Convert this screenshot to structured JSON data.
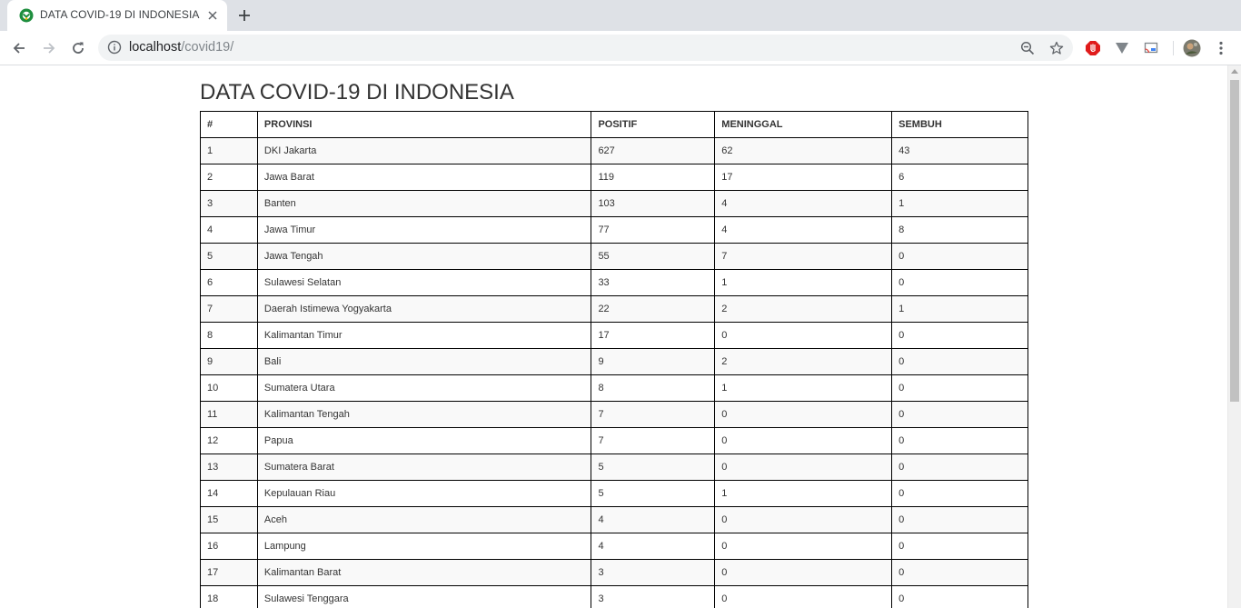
{
  "browser": {
    "tab_title": "DATA COVID-19 DI INDONESIA",
    "url_host": "localhost",
    "url_path": "/covid19/"
  },
  "page": {
    "title": "DATA COVID-19 DI INDONESIA",
    "table": {
      "headers": [
        "#",
        "PROVINSI",
        "POSITIF",
        "MENINGGAL",
        "SEMBUH"
      ],
      "rows": [
        [
          "1",
          "DKI Jakarta",
          "627",
          "62",
          "43"
        ],
        [
          "2",
          "Jawa Barat",
          "119",
          "17",
          "6"
        ],
        [
          "3",
          "Banten",
          "103",
          "4",
          "1"
        ],
        [
          "4",
          "Jawa Timur",
          "77",
          "4",
          "8"
        ],
        [
          "5",
          "Jawa Tengah",
          "55",
          "7",
          "0"
        ],
        [
          "6",
          "Sulawesi Selatan",
          "33",
          "1",
          "0"
        ],
        [
          "7",
          "Daerah Istimewa Yogyakarta",
          "22",
          "2",
          "1"
        ],
        [
          "8",
          "Kalimantan Timur",
          "17",
          "0",
          "0"
        ],
        [
          "9",
          "Bali",
          "9",
          "2",
          "0"
        ],
        [
          "10",
          "Sumatera Utara",
          "8",
          "1",
          "0"
        ],
        [
          "11",
          "Kalimantan Tengah",
          "7",
          "0",
          "0"
        ],
        [
          "12",
          "Papua",
          "7",
          "0",
          "0"
        ],
        [
          "13",
          "Sumatera Barat",
          "5",
          "0",
          "0"
        ],
        [
          "14",
          "Kepulauan Riau",
          "5",
          "1",
          "0"
        ],
        [
          "15",
          "Aceh",
          "4",
          "0",
          "0"
        ],
        [
          "16",
          "Lampung",
          "4",
          "0",
          "0"
        ],
        [
          "17",
          "Kalimantan Barat",
          "3",
          "0",
          "0"
        ],
        [
          "18",
          "Sulawesi Tenggara",
          "3",
          "0",
          "0"
        ]
      ]
    }
  },
  "icons": {
    "favicon": "green-shield-icon",
    "back": "arrow-left-icon",
    "forward": "arrow-right-icon",
    "reload": "reload-icon",
    "info": "info-circle-icon",
    "zoom": "zoom-out-icon",
    "bookmark": "star-icon",
    "ext1": "stop-hand-icon",
    "ext2": "triangle-icon",
    "ext3": "cast-icon",
    "profile": "avatar",
    "menu": "kebab-menu-icon"
  }
}
